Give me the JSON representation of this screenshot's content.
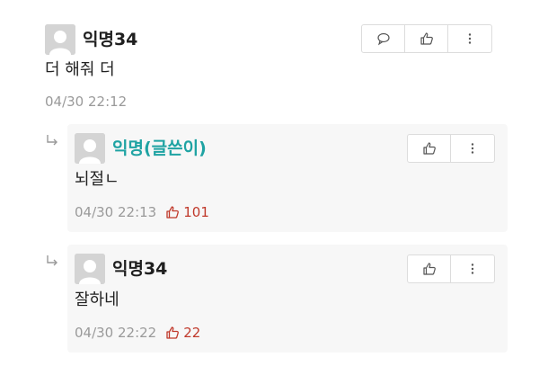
{
  "comments": [
    {
      "author": "익명34",
      "text": "더 해줘 더",
      "time": "04/30 22:12"
    }
  ],
  "replies": [
    {
      "author": "익명(글쓴이)",
      "text": "뇌절ㄴ",
      "time": "04/30 22:13",
      "likes": "101"
    },
    {
      "author": "익명34",
      "text": "잘하네",
      "time": "04/30 22:22",
      "likes": "22"
    }
  ],
  "colors": {
    "op_author": "#1fa3a3",
    "like": "#c0392b",
    "meta": "#9a9a9a",
    "reply_bg": "#f7f7f7"
  }
}
